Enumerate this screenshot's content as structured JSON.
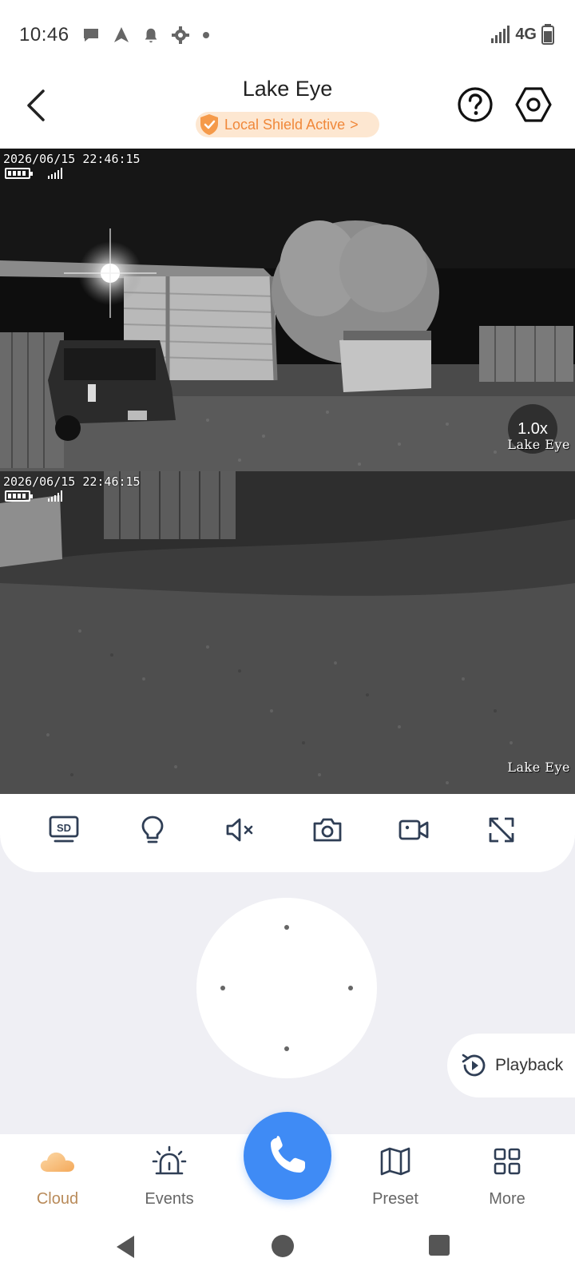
{
  "status_bar": {
    "time": "10:46",
    "network": "4G",
    "icons": [
      "chat-bubble-icon",
      "navigation-arrow-icon",
      "bell-icon",
      "gear-icon",
      "dot-icon"
    ]
  },
  "header": {
    "title": "Lake Eye",
    "shield_label": "Local Shield Active",
    "shield_chevron": ">",
    "accent_color": "#f0883a"
  },
  "cameras": [
    {
      "timestamp": "2026/06/15 22:46:15",
      "name_overlay": "Lake Eye",
      "zoom": "1.0x"
    },
    {
      "timestamp": "2026/06/15 22:46:15",
      "name_overlay": "Lake Eye"
    }
  ],
  "toolbar": {
    "items": [
      "sd-quality-icon",
      "light-bulb-icon",
      "mute-icon",
      "snapshot-camera-icon",
      "record-video-icon",
      "fullscreen-icon"
    ]
  },
  "playback": {
    "label": "Playback"
  },
  "bottom_nav": {
    "items": [
      {
        "label": "Cloud",
        "icon": "cloud-icon",
        "active": true
      },
      {
        "label": "Events",
        "icon": "alarm-icon",
        "active": false
      },
      {
        "label": "Preset",
        "icon": "map-icon",
        "active": false
      },
      {
        "label": "More",
        "icon": "grid-icon",
        "active": false
      }
    ],
    "call_color": "#3f8bf5",
    "active_color": "#b98b5a"
  }
}
